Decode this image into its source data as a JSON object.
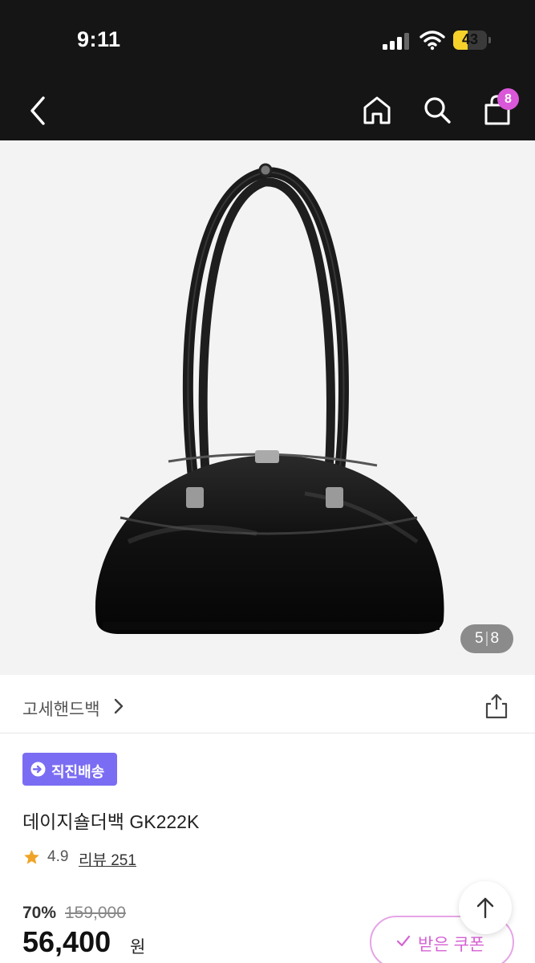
{
  "status_bar": {
    "time": "9:11",
    "battery": "43",
    "battery_level": 0.43
  },
  "header": {
    "bag_count": "8"
  },
  "gallery": {
    "current": "5",
    "total": "8"
  },
  "brand": {
    "name": "고세핸드백"
  },
  "product": {
    "badge": "직진배송",
    "name": "데이지숄더백 GK222K",
    "rating": "4.9",
    "review_link": "리뷰 251",
    "discount": "70%",
    "original_price": "159,000",
    "price": "56,400",
    "price_unit": "원"
  },
  "coupon": {
    "label": "받은 쿠폰"
  },
  "colors": {
    "topbar": "#151515",
    "badge_bg": "#7b6df3",
    "accent_pink": "#d562d4",
    "star": "#f0a427"
  }
}
